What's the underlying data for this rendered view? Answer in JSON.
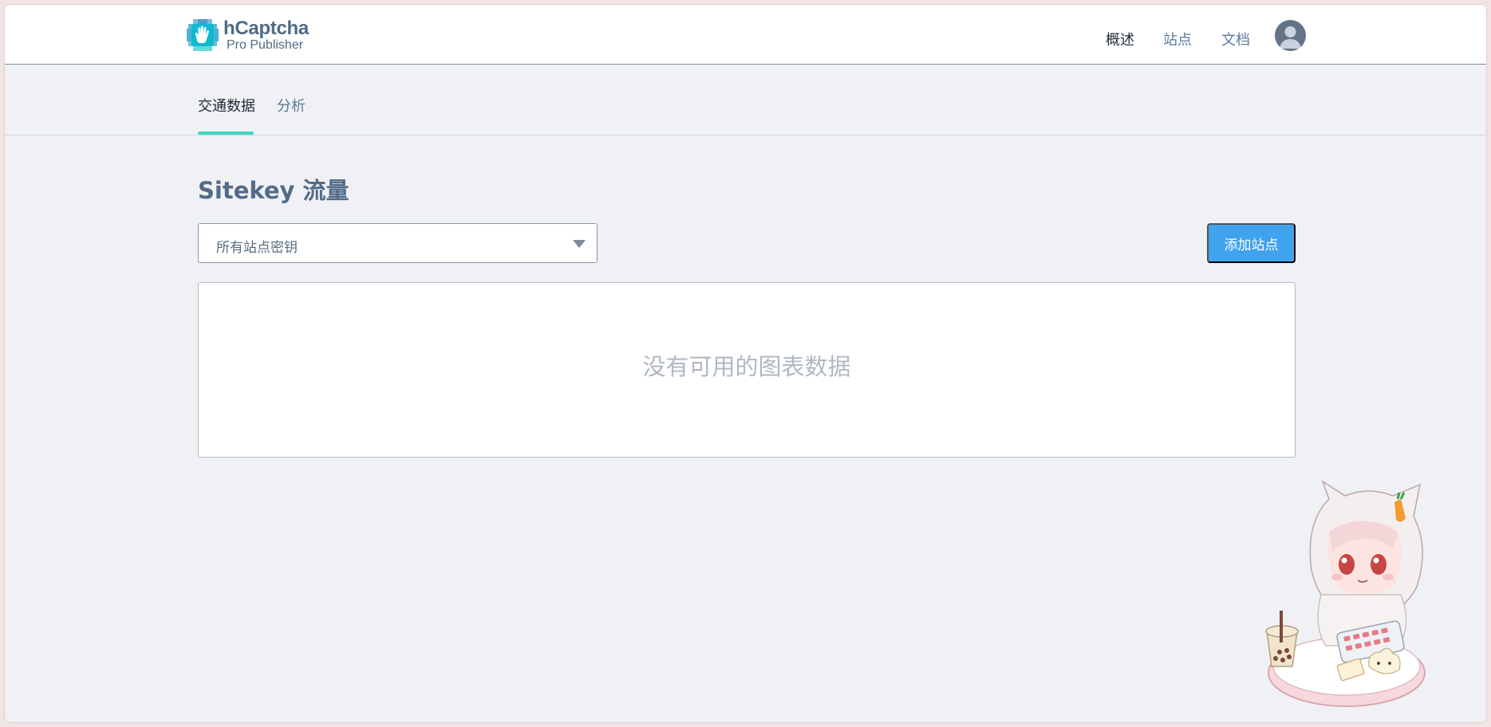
{
  "brand": {
    "name": "hCaptcha",
    "subtitle": "Pro Publisher"
  },
  "topnav": [
    {
      "label": "概述",
      "active": true
    },
    {
      "label": "站点",
      "active": false
    },
    {
      "label": "文档",
      "active": false
    }
  ],
  "tabs": [
    {
      "label": "交通数据",
      "active": true
    },
    {
      "label": "分析",
      "active": false
    }
  ],
  "page": {
    "title": "Sitekey 流量"
  },
  "sitekey_select": {
    "value": "所有站点密钥"
  },
  "add_site_button": {
    "label": "添加站点"
  },
  "chart": {
    "empty_message": "没有可用的图表数据"
  },
  "colors": {
    "accent": "#3ed6c4",
    "button": "#3fa3ee",
    "brand_text": "#4e6a86",
    "background": "#eff1f5"
  },
  "icons": {
    "avatar": "user-avatar-icon",
    "caret": "caret-down-icon",
    "logo": "hcaptcha-hand-logo-icon"
  }
}
